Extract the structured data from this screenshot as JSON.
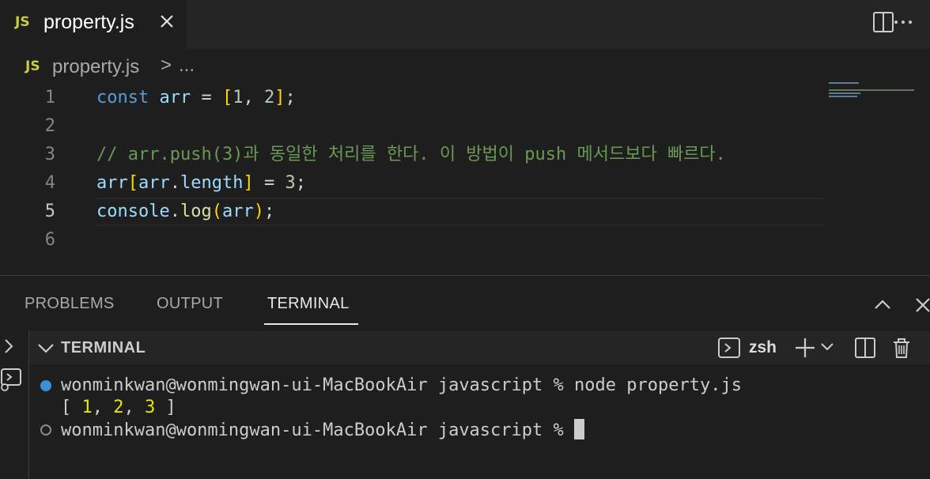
{
  "tab": {
    "badge": "JS",
    "title": "property.js"
  },
  "breadcrumb": {
    "badge": "JS",
    "file": "property.js",
    "separator": ">",
    "more": "..."
  },
  "editor": {
    "current_line": 5,
    "lines": [
      {
        "number": "1"
      },
      {
        "number": "2"
      },
      {
        "number": "3"
      },
      {
        "number": "4"
      },
      {
        "number": "5"
      },
      {
        "number": "6"
      }
    ],
    "tokens": {
      "l1_kw": "const",
      "l1_var": "arr",
      "l1_eq": " = ",
      "l1_ob": "[",
      "l1_n1": "1",
      "l1_comma": ", ",
      "l1_n2": "2",
      "l1_cb": "]",
      "l1_semi": ";",
      "l3_comment": "// arr.push(3)과 동일한 처리를 한다. 이 방법이 push 메서드보다 빠르다.",
      "l4_var1": "arr",
      "l4_ob": "[",
      "l4_var2": "arr",
      "l4_dot": ".",
      "l4_prop": "length",
      "l4_cb": "]",
      "l4_eq": " = ",
      "l4_num": "3",
      "l4_semi": ";",
      "l5_obj": "console",
      "l5_dot": ".",
      "l5_fn": "log",
      "l5_op": "(",
      "l5_arg": "arr",
      "l5_cp": ")",
      "l5_semi": ";"
    }
  },
  "panel": {
    "tabs": {
      "problems": "PROBLEMS",
      "output": "OUTPUT",
      "terminal": "TERMINAL"
    },
    "active_tab": "TERMINAL"
  },
  "terminal": {
    "section_title": "TERMINAL",
    "shell": "zsh",
    "line1_prompt": "wonminkwan@wonmingwan-ui-MacBookAir javascript % ",
    "line1_cmd": "node property.js",
    "line2_open": "[ ",
    "line2_n1": "1",
    "line2_c1": ", ",
    "line2_n2": "2",
    "line2_c2": ", ",
    "line2_n3": "3",
    "line2_close": " ]",
    "line3_prompt": "wonminkwan@wonmingwan-ui-MacBookAir javascript % "
  },
  "colors": {
    "editor_bg": "#1e1e1e",
    "tabbar_bg": "#252526",
    "keyword": "#569cd6",
    "variable": "#9cdcfe",
    "number": "#b5cea8",
    "comment": "#6a9955",
    "bracket": "#ffd700",
    "function": "#dcdcaa",
    "js_badge": "#cbcb41",
    "status_dot_blue": "#3c8fd6"
  }
}
